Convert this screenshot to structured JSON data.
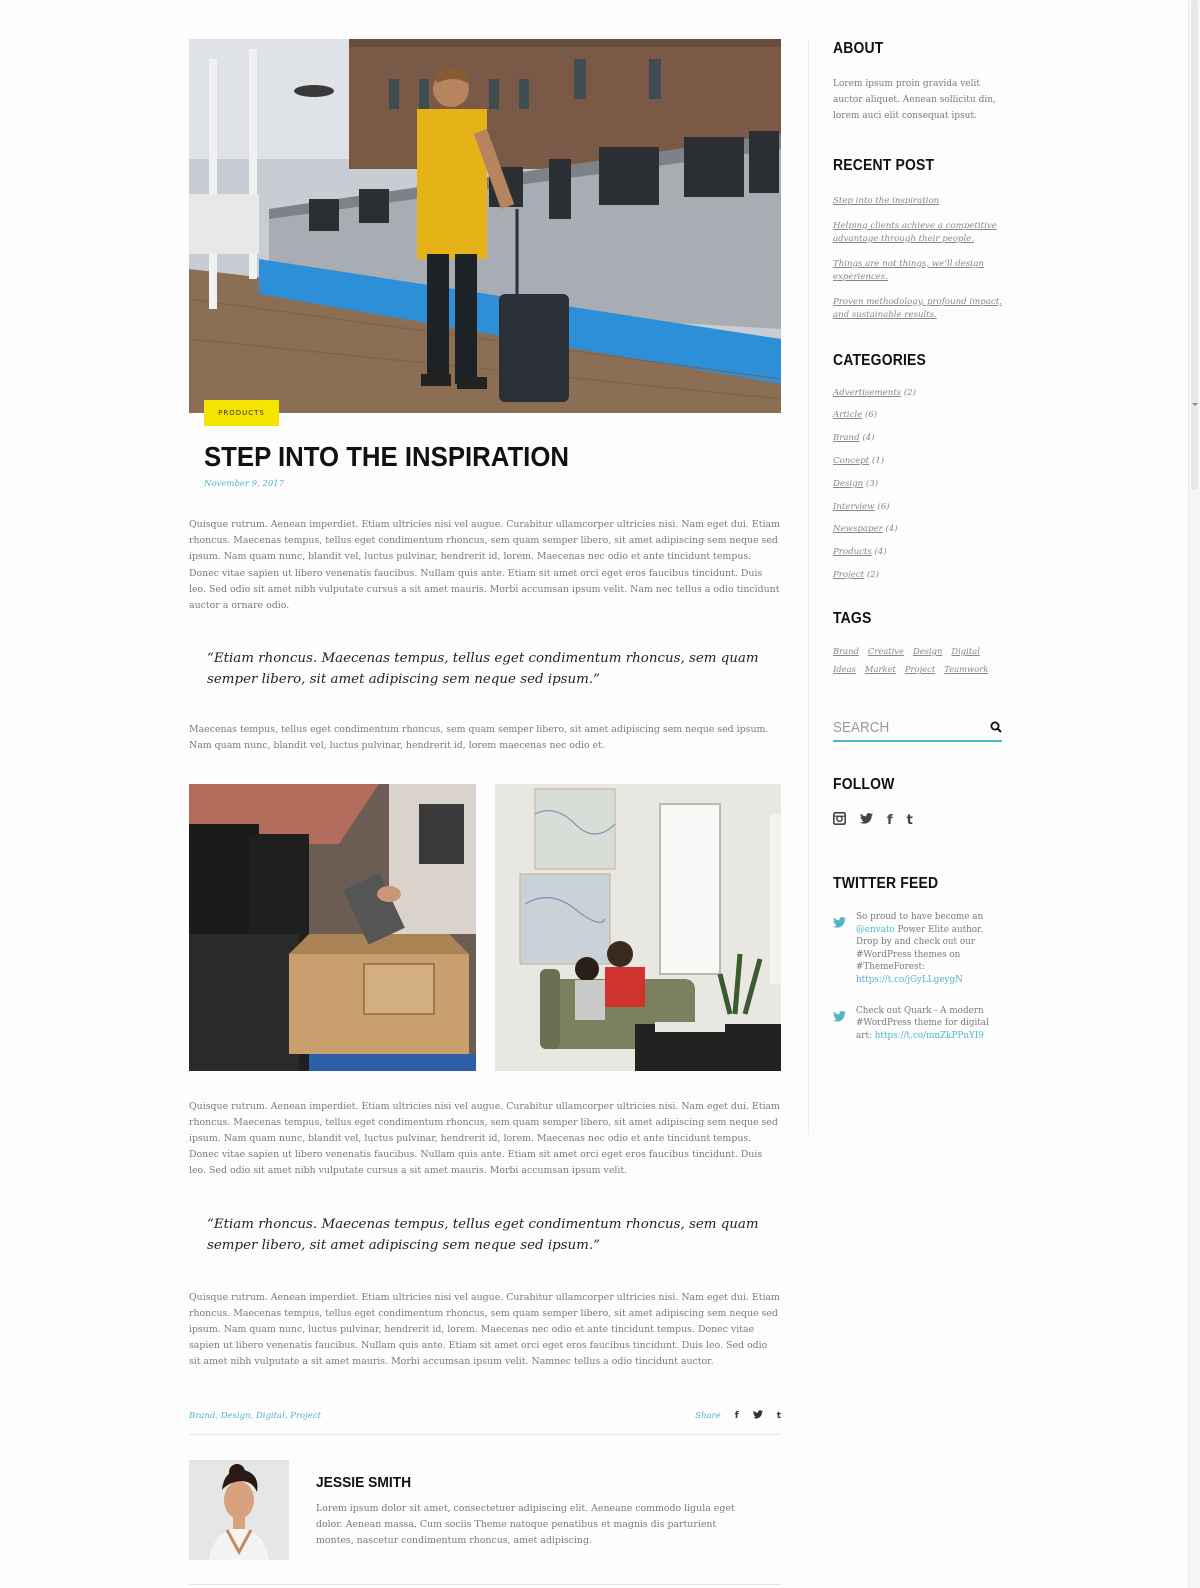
{
  "post": {
    "category_badge": "PRODUCTS",
    "title": "STEP INTO THE INSPIRATION",
    "date": "November 9, 2017",
    "paragraph_1": "Quisque rutrum. Aenean imperdiet. Etiam ultricies nisi vel augue. Curabitur ullamcorper ultricies nisi. Nam eget dui. Etiam rhoncus. Maecenas tempus, tellus eget condimentum rhoncus, sem quam semper libero, sit amet adipiscing sem neque sed ipsum. Nam quam nunc, blandit vel, luctus pulvinar, hendrerit id, lorem. Maecenas nec odio et ante tincidunt tempus. Donec vitae sapien ut libero venenatis faucibus. Nullam quis ante. Etiam sit amet orci eget eros faucibus tincidunt. Duis leo. Sed odio sit amet nibh vulputate cursus a sit amet mauris. Morbi accumsan ipsum velit. Nam nec tellus a odio tincidunt auctor a ornare odio.",
    "quote_1": "“Etiam rhoncus. Maecenas tempus, tellus eget condimentum rhoncus, sem quam semper libero, sit amet adipiscing sem neque sed ipsum.”",
    "paragraph_2": "Maecenas tempus, tellus eget condimentum rhoncus, sem quam semper libero, sit amet adipiscing sem neque sed ipsum. Nam quam nunc, blandit vel, luctus pulvinar, hendrerit id, lorem maecenas nec odio et.",
    "paragraph_3": "Quisque rutrum. Aenean imperdiet. Etiam ultricies nisi vel augue. Curabitur ullamcorper ultricies nisi. Nam eget dui. Etiam rhoncus. Maecenas tempus, tellus eget condimentum rhoncus, sem quam semper libero, sit amet adipiscing sem neque sed ipsum. Nam quam nunc, blandit vel, luctus pulvinar, hendrerit id, lorem. Maecenas nec odio et ante tincidunt tempus. Donec vitae sapien ut libero venenatis faucibus. Nullam quis ante. Etiam sit amet orci eget eros faucibus tincidunt. Duis leo. Sed odio sit amet nibh vulputate cursus a sit amet mauris. Morbi accumsan ipsum velit.",
    "quote_2": "“Etiam rhoncus. Maecenas tempus, tellus eget condimentum rhoncus, sem quam semper libero, sit amet adipiscing sem neque sed ipsum.”",
    "paragraph_4": "Quisque rutrum. Aenean imperdiet. Etiam ultricies nisi vel augue. Curabitur ullamcorper ultricies nisi. Nam eget dui. Etiam rhoncus. Maecenas tempus, tellus eget condimentum rhoncus, sem quam semper libero, sit amet adipiscing sem neque sed ipsum. Nam quam nunc, luctus pulvinar, hendrerit id, lorem. Maecenas nec odio et ante tincidunt tempus. Donec vitae sapien ut libero venenatis faucibus. Nullam quis ante. Etiam sit amet orci eget eros faucibus tincidunt. Duis leo. Sed odio sit amet nibh vulputate a sit amet mauris. Morbi accumsan ipsum velit. Namnec tellus a odio tincidunt auctor.",
    "tags": [
      "Brand",
      "Design",
      "Digital",
      "Project"
    ],
    "share_label": "Share",
    "share_icons": [
      "f",
      "t-bird",
      "t"
    ]
  },
  "author": {
    "name": "JESSIE SMITH",
    "bio": "Lorem ipsum dolor sit amet, consectetuer adipiscing elit. Aeneane commodo ligula eget dolor. Aenean massa. Cum sociis Theme natoque penatibus et magnis dis parturient montes, nascetur condimentum rhoncus, amet adipiscing."
  },
  "sidebar": {
    "about_title": "ABOUT",
    "about_text": "Lorem ipsum proin gravida velit auctor aliquet. Aenean sollicitu din, lorem auci elit consequat ipsut.",
    "recent_title": "RECENT POST",
    "recent_posts": [
      "Step into the inspiration",
      "Helping clients achieve a competitive advantage through their people.",
      "Things are not things, we’ll design experiences.",
      "Proven methodology, profound impact, and sustainable results."
    ],
    "categories_title": "CATEGORIES",
    "categories": [
      {
        "name": "Advertisements",
        "count": "(2)"
      },
      {
        "name": "Article",
        "count": "(6)"
      },
      {
        "name": "Brand",
        "count": "(4)"
      },
      {
        "name": "Concept",
        "count": "(1)"
      },
      {
        "name": "Design",
        "count": "(3)"
      },
      {
        "name": "Interview",
        "count": "(6)"
      },
      {
        "name": "Newspaper",
        "count": "(4)"
      },
      {
        "name": "Products",
        "count": "(4)"
      },
      {
        "name": "Project",
        "count": "(2)"
      }
    ],
    "tags_title": "TAGS",
    "tags": [
      "Brand",
      "Creative",
      "Design",
      "Digital",
      "Ideas",
      "Market",
      "Project",
      "Teamwork"
    ],
    "search_placeholder": "SEARCH",
    "follow_title": "FOLLOW",
    "twitter_title": "TWITTER FEED",
    "tweet_1": {
      "pre": "So proud to have become an ",
      "handle": "@envato",
      "mid": " Power Elite author. Drop by and check out our #WordPress themes on #ThemeForest: ",
      "link": "https://t.co/jGyLLgeygN"
    },
    "tweet_2": {
      "pre": "Check out Quark - A modern #WordPress theme for digital art: ",
      "link": "https://t.co/mnZkPPnYI9"
    }
  },
  "colors": {
    "accent": "#4fb6c9",
    "badge": "#f5e400"
  }
}
